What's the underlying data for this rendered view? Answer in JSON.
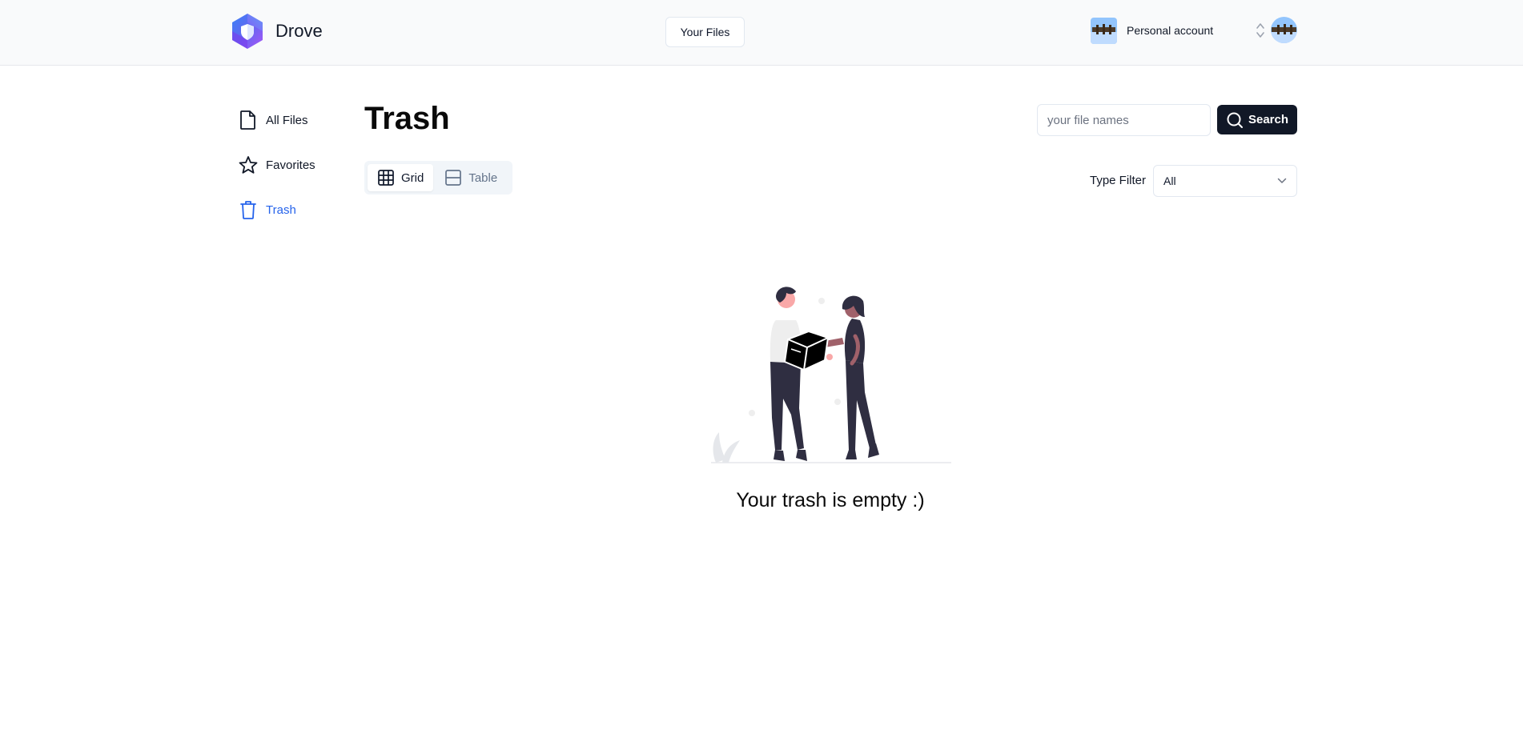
{
  "app": {
    "name": "Drove"
  },
  "header": {
    "your_files_label": "Your Files",
    "account_label": "Personal account"
  },
  "sidebar": {
    "items": [
      {
        "label": "All Files",
        "icon": "file-icon",
        "active": false
      },
      {
        "label": "Favorites",
        "icon": "star-icon",
        "active": false
      },
      {
        "label": "Trash",
        "icon": "trash-icon",
        "active": true
      }
    ]
  },
  "main": {
    "title": "Trash",
    "view_toggle": {
      "grid_label": "Grid",
      "table_label": "Table",
      "selected": "Grid"
    },
    "search": {
      "placeholder": "your file names",
      "value": "",
      "button_label": "Search"
    },
    "type_filter": {
      "label": "Type Filter",
      "value": "All"
    },
    "empty_state": {
      "message": "Your trash is empty :)"
    }
  },
  "colors": {
    "accent": "#2563eb",
    "primary_button": "#111827",
    "header_bg": "#f9fafb",
    "figure_dark": "#2f2e41"
  }
}
